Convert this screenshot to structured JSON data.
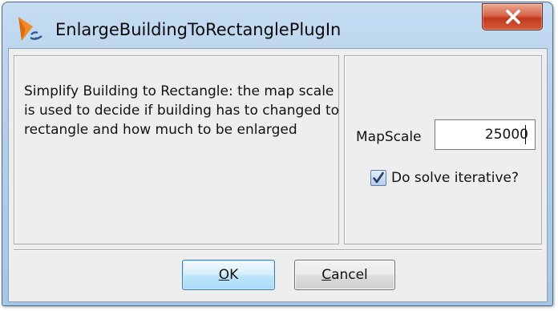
{
  "window": {
    "title": "EnlargeBuildingToRectanglePlugIn",
    "close_symbol": "X",
    "icon": "jump-app-icon"
  },
  "description": {
    "text": "Simplify Building to Rectangle: the map scale is used to decide if building has to changed to rectangle and how much to be enlarged"
  },
  "form": {
    "map_scale_label": "MapScale",
    "map_scale_value": "25000",
    "iterative_label": "Do solve iterative?",
    "iterative_checked": true
  },
  "buttons": {
    "ok_mnemonic": "O",
    "ok_rest": "K",
    "cancel_mnemonic": "C",
    "cancel_rest": "ancel"
  },
  "colors": {
    "title_bar": "#b3cfec",
    "close_button": "#c2391f",
    "dialog_body": "#eeeeee",
    "default_button_border": "#3c7fb1"
  }
}
